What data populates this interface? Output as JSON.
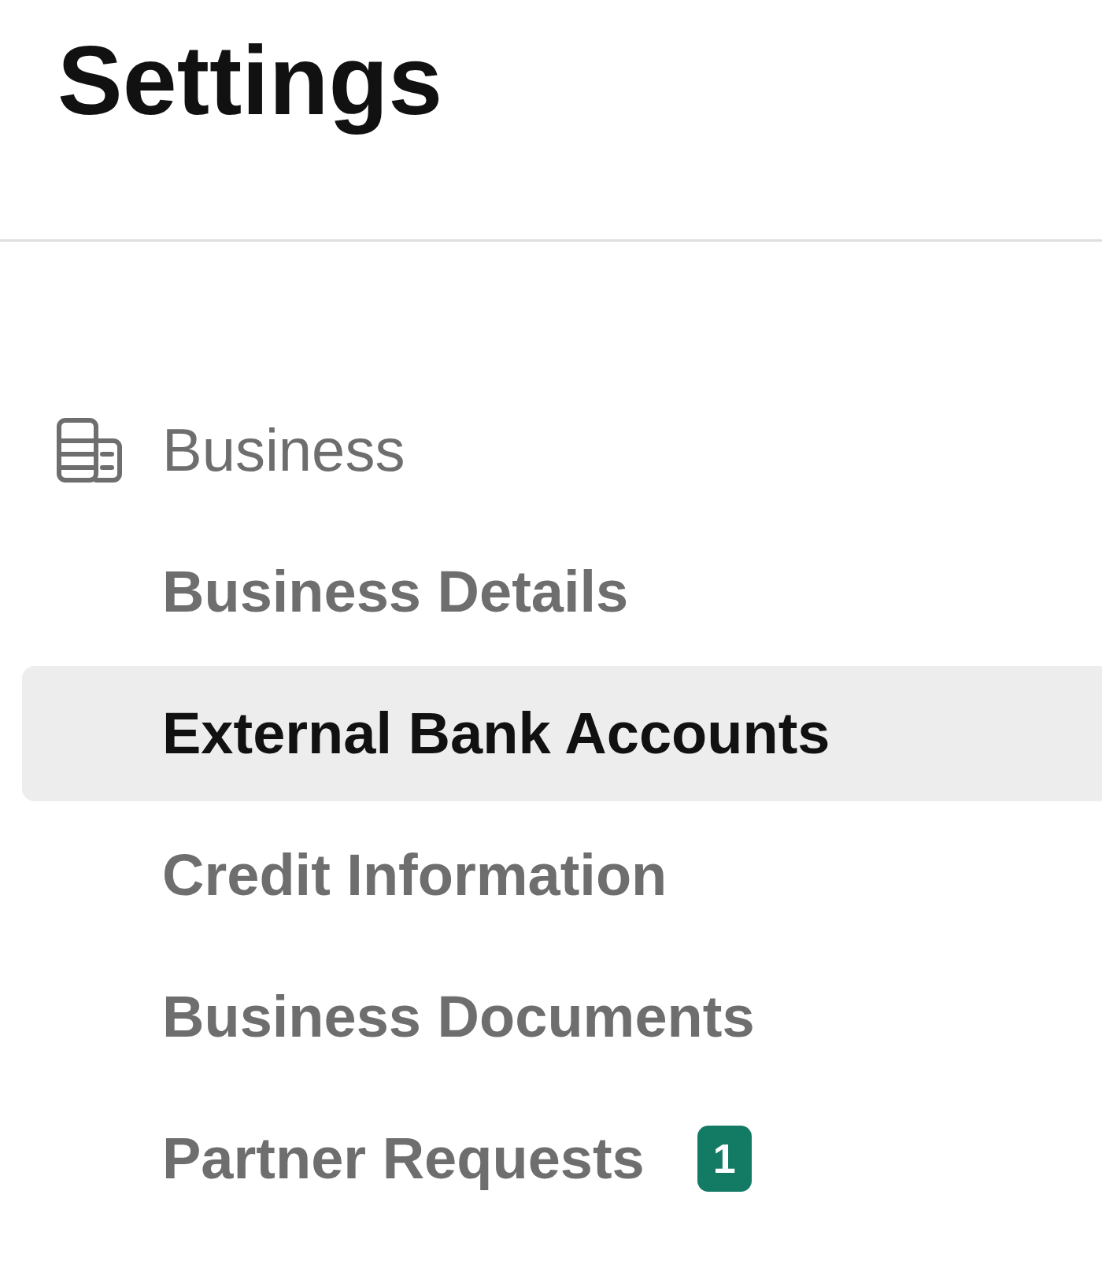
{
  "title": "Settings",
  "section": {
    "label": "Business",
    "items": [
      {
        "label": "Business Details",
        "selected": false
      },
      {
        "label": "External Bank Accounts",
        "selected": true
      },
      {
        "label": "Credit Information",
        "selected": false
      },
      {
        "label": "Business Documents",
        "selected": false
      },
      {
        "label": "Partner Requests",
        "selected": false,
        "badge": "1"
      }
    ]
  }
}
